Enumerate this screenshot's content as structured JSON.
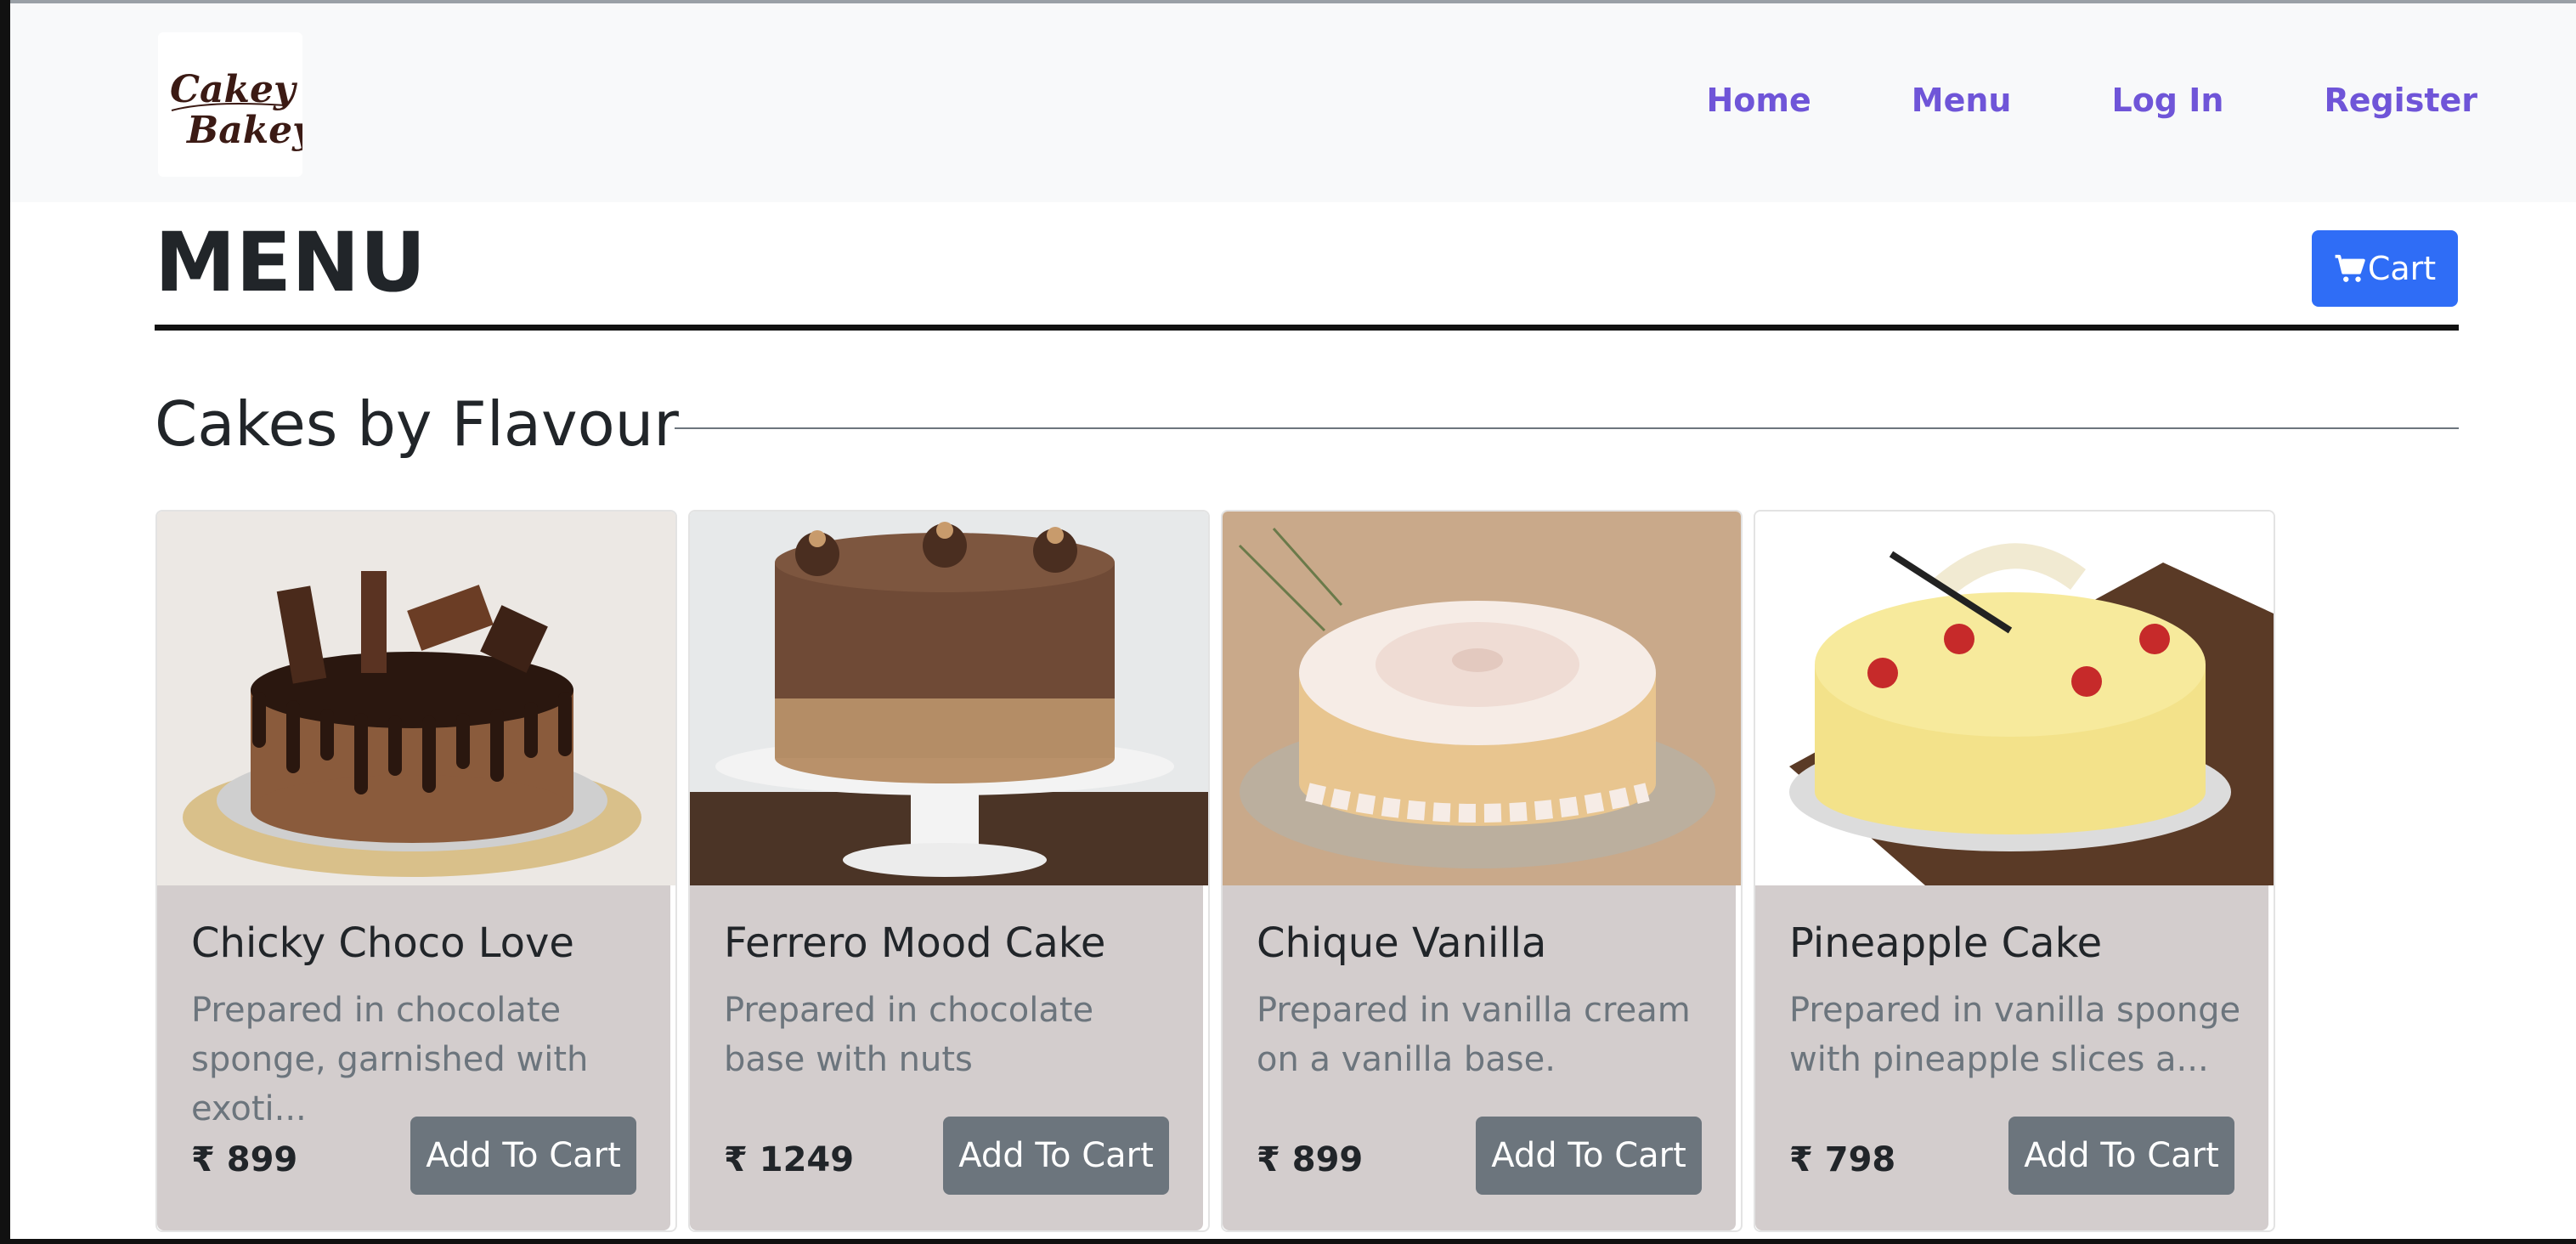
{
  "nav": {
    "logo_text_line1": "Cakey",
    "logo_text_line2": "Bakey",
    "links": [
      "Home",
      "Menu",
      "Log In",
      "Register"
    ]
  },
  "page": {
    "title": "MENU",
    "cart_label": "Cart",
    "section_title": "Cakes by Flavour"
  },
  "products": [
    {
      "name": "Chicky Choco Love",
      "description": "Prepared in chocolate sponge, garnished with exoti...",
      "price": "₹ 899",
      "button": "Add To Cart"
    },
    {
      "name": "Ferrero Mood Cake",
      "description": "Prepared in chocolate base with nuts",
      "price": "₹ 1249",
      "button": "Add To Cart"
    },
    {
      "name": "Chique Vanilla",
      "description": "Prepared in vanilla cream on a vanilla base.",
      "price": "₹ 899",
      "button": "Add To Cart"
    },
    {
      "name": "Pineapple Cake",
      "description": "Prepared in vanilla sponge with pineapple slices a...",
      "price": "₹ 798",
      "button": "Add To Cart"
    }
  ],
  "colors": {
    "nav_link": "#6f55d8",
    "cart_button": "#2f6df6",
    "card_body": "#d3cdcd",
    "add_button": "#6c757d"
  }
}
